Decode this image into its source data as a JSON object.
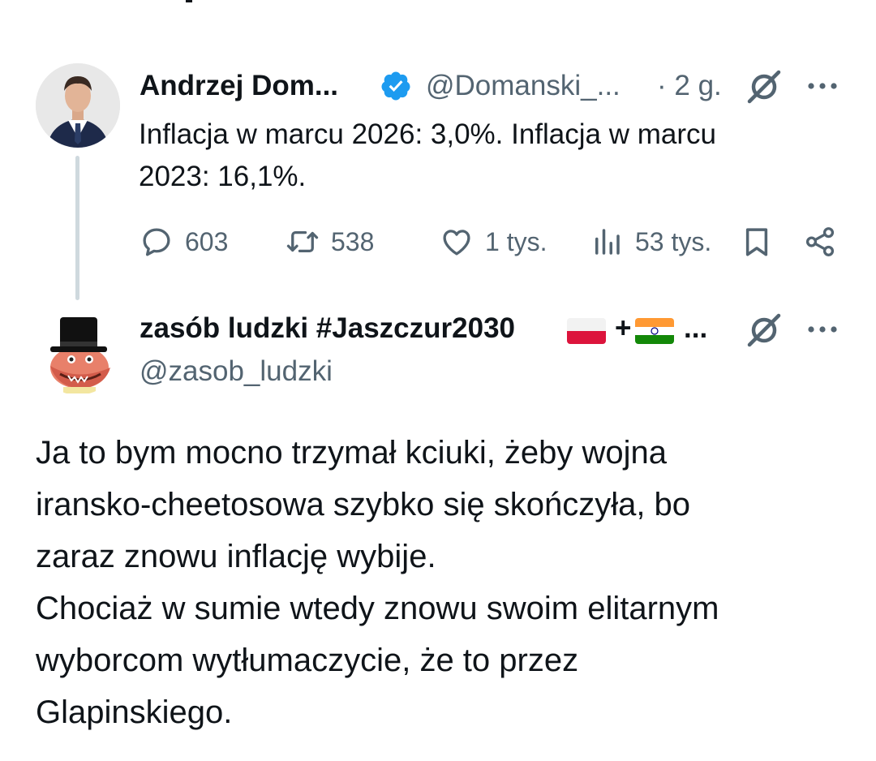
{
  "tweet1": {
    "author_name": "Andrzej Dom...",
    "handle": "@Domanski_...",
    "time": "· 2 g.",
    "text": "Inflacja w marcu 2026: 3,0%. Inflacja w marcu\n2023: 16,1%.",
    "stats": {
      "replies": "603",
      "retweets": "538",
      "likes": "1 tys.",
      "views": "53 tys."
    }
  },
  "tweet2": {
    "author_name": "zasób ludzki #Jaszczur2030",
    "name_plus": "+",
    "name_ellipsis": "...",
    "handle": "@zasob_ludzki",
    "text": "Ja to bym mocno trzymał kciuki, żeby wojna\niransko-cheetosowa szybko się skończyła, bo\nzaraz znowu inflację wybije.\nChociaż w sumie wtedy znowu swoim elitarnym\nwyborcom wytłumaczycie, że to przez\nGlapinskiego."
  },
  "icons": {
    "verified": "verified-badge-icon",
    "grok": "grok-icon",
    "more": "more-dots-icon",
    "reply": "reply-icon",
    "retweet": "retweet-icon",
    "like": "heart-icon",
    "views": "views-bar-icon",
    "bookmark": "bookmark-icon",
    "share": "share-icon"
  },
  "colors": {
    "text": "#0f1419",
    "secondary": "#536471",
    "verified": "#1d9bf0",
    "thread_line": "#cfd9de"
  }
}
